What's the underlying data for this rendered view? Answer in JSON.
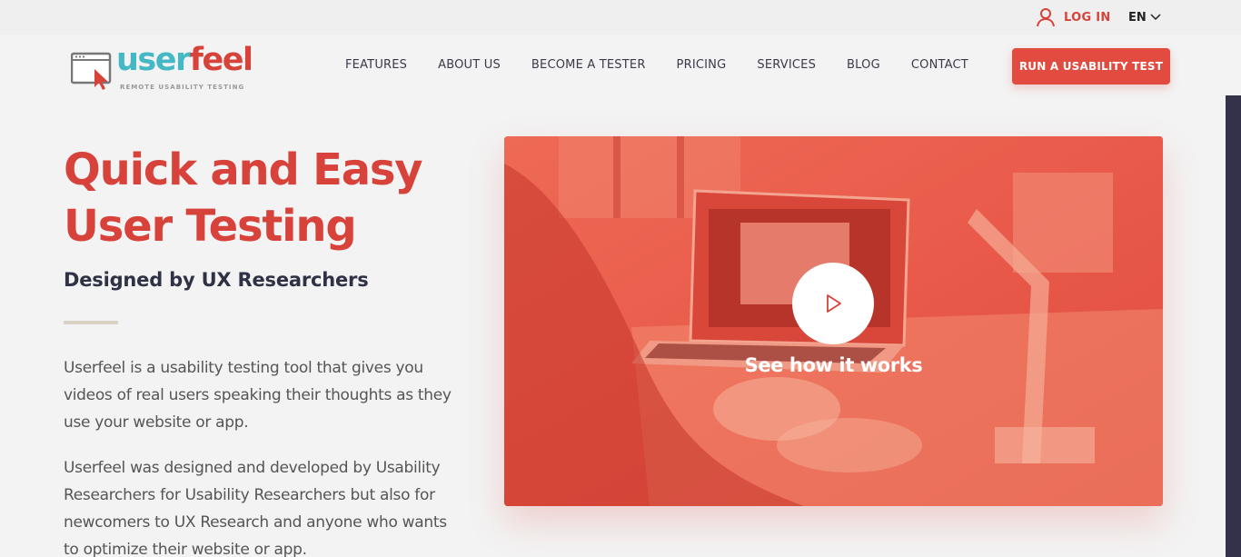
{
  "topbar": {
    "login_label": "LOG IN",
    "language": "EN"
  },
  "logo": {
    "word_part1": "user",
    "word_part2": "feel",
    "tagline": "REMOTE USABILITY TESTING"
  },
  "nav": {
    "items": [
      {
        "label": "FEATURES"
      },
      {
        "label": "ABOUT US"
      },
      {
        "label": "BECOME A TESTER"
      },
      {
        "label": "PRICING"
      },
      {
        "label": "SERVICES"
      },
      {
        "label": "BLOG"
      },
      {
        "label": "CONTACT"
      }
    ],
    "cta_label": "RUN A USABILITY TEST"
  },
  "hero": {
    "title_line1": "Quick and Easy",
    "title_line2": "User Testing",
    "subtitle": "Designed by UX Researchers",
    "paragraph1": "Userfeel is a usability testing tool that gives you videos of real users speaking their thoughts as they use your website or app.",
    "paragraph2": "Userfeel was designed and developed by Usability Researchers for Usability Researchers but also for newcomers to UX Research and anyone who wants to optimize their website or app."
  },
  "video": {
    "caption": "See how it works",
    "icon": "play-icon"
  },
  "colors": {
    "brand_red": "#d7423a",
    "brand_teal": "#44b8c5",
    "cta_bg": "#e14b40",
    "text_dark": "#2f3245"
  }
}
